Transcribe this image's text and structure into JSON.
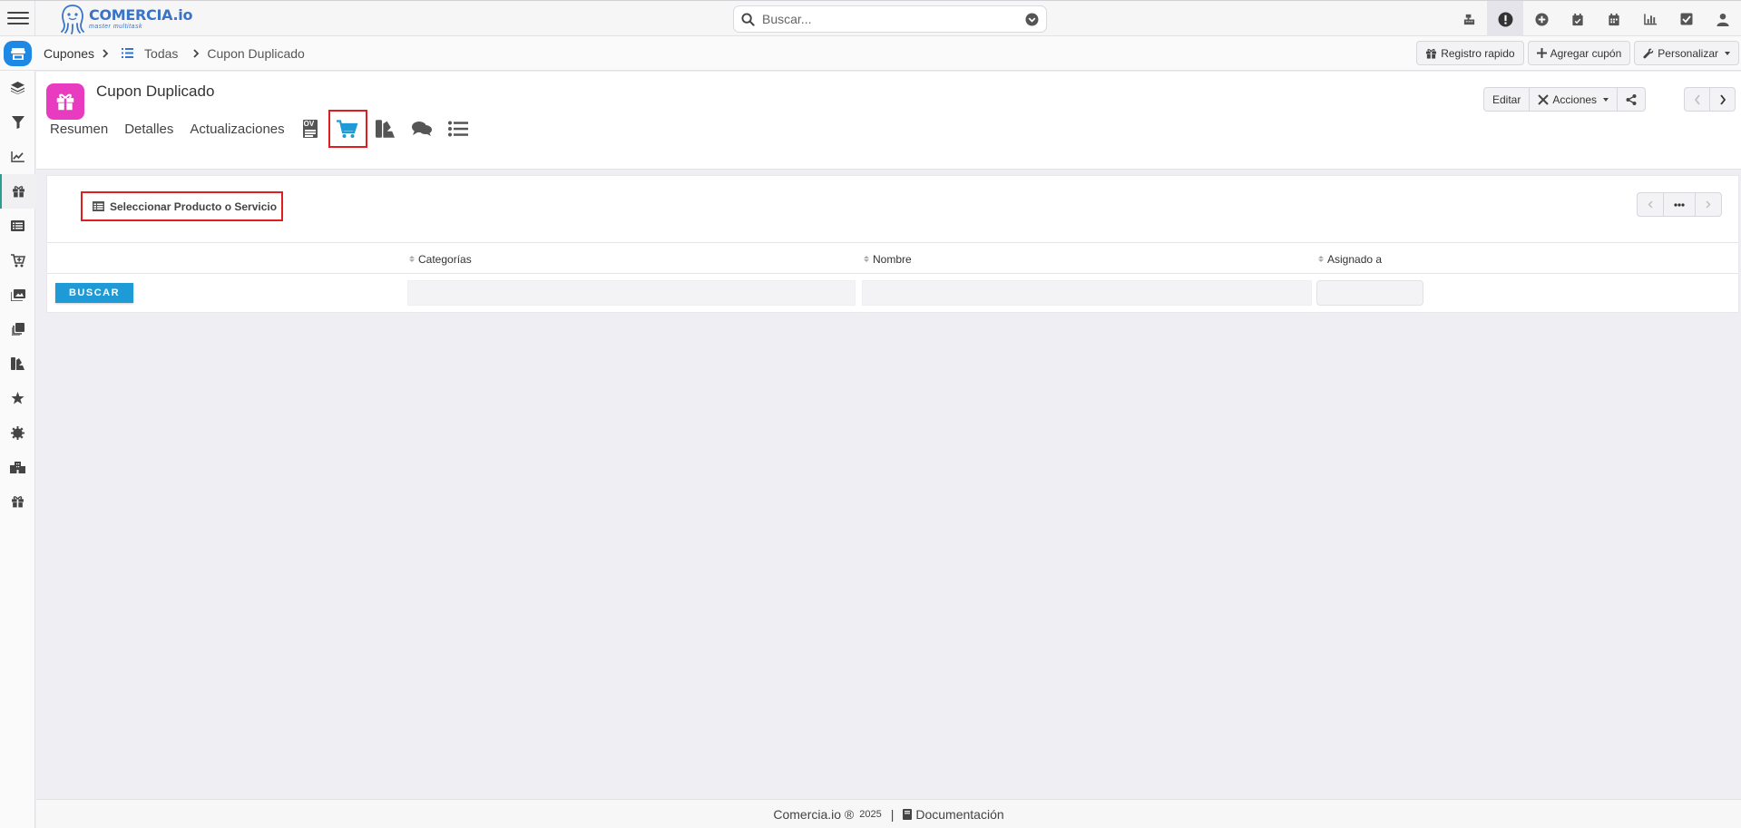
{
  "app": {
    "logo_name": "COMERCIA.io",
    "logo_sub": "master multitask",
    "search_placeholder": "Buscar..."
  },
  "top_icons": [
    "cash-register-icon",
    "alert-icon",
    "plus-circle-icon",
    "calendar-check-icon",
    "calendar-icon",
    "chart-bar-icon",
    "check-square-icon",
    "user-icon"
  ],
  "breadcrumb": {
    "module": "Cupones",
    "list": "Todas",
    "current": "Cupon Duplicado"
  },
  "crumb_actions": {
    "quick": "Registro rapido",
    "add": "Agregar cupón",
    "customize": "Personalizar"
  },
  "sidebar": [
    "layers-icon",
    "filter-icon",
    "chart-line-icon",
    "gift-icon",
    "list-icon",
    "cart-plus-icon",
    "images-icon",
    "copy-icon",
    "swatches-icon",
    "star-icon",
    "gear-icon",
    "building-icon",
    "gift-icon"
  ],
  "record": {
    "title": "Cupon Duplicado",
    "edit": "Editar",
    "actions": "Acciones"
  },
  "tabs": {
    "resumen": "Resumen",
    "detalles": "Detalles",
    "actualizaciones": "Actualizaciones",
    "ov_badge": "OV"
  },
  "subpanel": {
    "select_button": "Seleccionar Producto o Servicio",
    "columns": {
      "categorias": "Categorías",
      "nombre": "Nombre",
      "asignado": "Asignado a"
    },
    "search_button": "BUSCAR"
  },
  "footer": {
    "brand": "Comercia.io ®",
    "year": "2025",
    "sep": "|",
    "docs": "Documentación"
  },
  "colors": {
    "accent_blue": "#1e88e5",
    "record_icon": "#e83bc0",
    "highlight_red": "#e01e1e",
    "tab_selected": "#1e9ad6"
  }
}
